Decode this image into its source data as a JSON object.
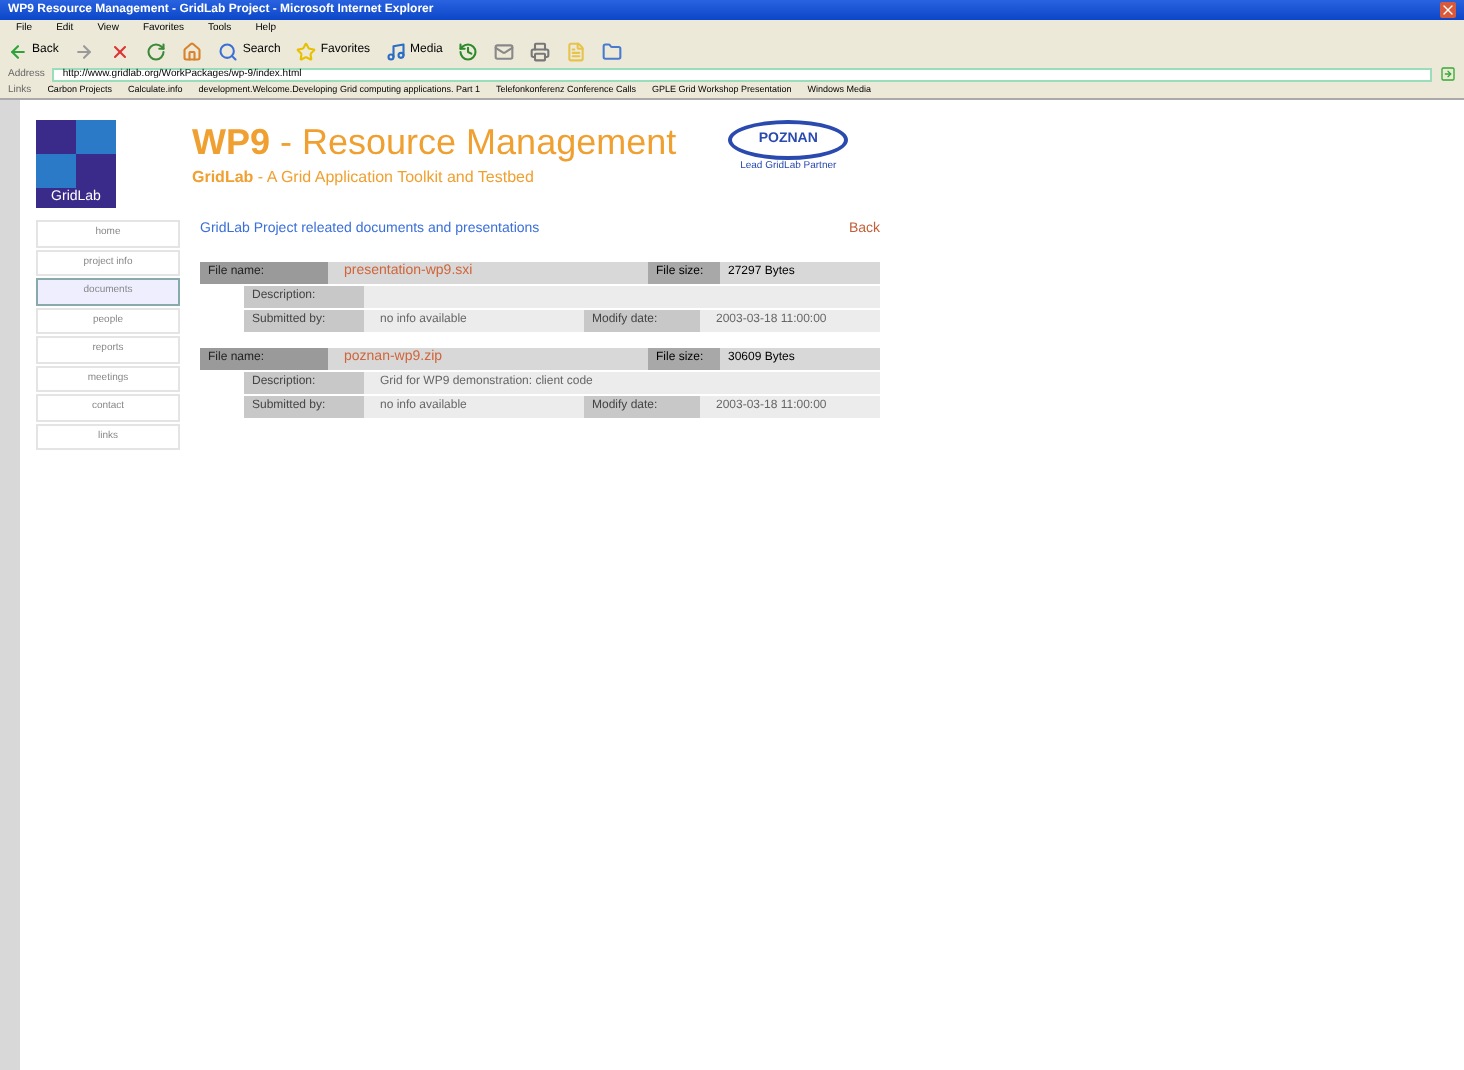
{
  "window": {
    "title": "WP9 Resource Management - GridLab Project - Microsoft Internet Explorer"
  },
  "menu": [
    "File",
    "Edit",
    "View",
    "Favorites",
    "Tools",
    "Help"
  ],
  "toolbar": [
    {
      "kind": "back",
      "label": "Back"
    },
    {
      "kind": "forward"
    },
    {
      "kind": "stop"
    },
    {
      "kind": "refresh"
    },
    {
      "kind": "home"
    },
    {
      "kind": "search",
      "label": "Search"
    },
    {
      "kind": "favorites",
      "label": "Favorites"
    },
    {
      "kind": "media",
      "label": "Media"
    },
    {
      "kind": "history"
    },
    {
      "kind": "mail"
    },
    {
      "kind": "print"
    },
    {
      "kind": "edit"
    },
    {
      "kind": "folder"
    }
  ],
  "address": {
    "label": "Address",
    "value": "http://www.gridlab.org/WorkPackages/wp-9/index.html"
  },
  "links": {
    "label": "Links",
    "items": [
      "Carbon Projects",
      "Calculate.info",
      "development.Welcome.Developing Grid computing applications. Part 1",
      "Telefonkonferenz Conference Calls",
      "GPLE Grid Workshop Presentation",
      "Windows Media"
    ]
  },
  "header": {
    "logo_text": "GridLab",
    "title_strong": "WP9",
    "title_rest": " - Resource Management",
    "subtitle_strong": "GridLab",
    "subtitle_rest": " - A Grid Application Toolkit and Testbed",
    "partner_logo": "POZNAN",
    "partner_caption": "Lead GridLab Partner"
  },
  "sidebar": [
    {
      "label": "home",
      "selected": false
    },
    {
      "label": "project info",
      "selected": false
    },
    {
      "label": "documents",
      "selected": true
    },
    {
      "label": "people",
      "selected": false
    },
    {
      "label": "reports",
      "selected": false
    },
    {
      "label": "meetings",
      "selected": false
    },
    {
      "label": "contact",
      "selected": false
    },
    {
      "label": "links",
      "selected": false
    }
  ],
  "content": {
    "heading": "GridLab Project releated documents and presentations",
    "back": "Back",
    "documents": [
      {
        "file_name_label": "File name:",
        "file_name": "presentation-wp9.sxi",
        "size_label": "File size:",
        "size": "27297 Bytes",
        "description_label": "Description:",
        "submitted_label": "Submitted by:",
        "submitted_by": "no info available",
        "date_label": "Modify date:",
        "date": "2003-03-18 11:00:00"
      },
      {
        "file_name_label": "File name:",
        "file_name": "poznan-wp9.zip",
        "size_label": "File size:",
        "size": "30609 Bytes",
        "description_label": "Description:",
        "description": "Grid for WP9 demonstration: client code",
        "submitted_label": "Submitted by:",
        "submitted_by": "no info available",
        "date_label": "Modify date:",
        "date": "2003-03-18 11:00:00"
      }
    ]
  }
}
